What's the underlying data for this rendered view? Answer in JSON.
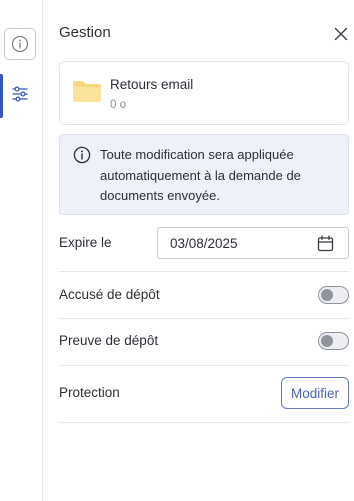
{
  "rail": {
    "items": [
      {
        "icon": "info-icon",
        "active": false
      },
      {
        "icon": "sliders-icon",
        "active": true
      }
    ],
    "accent_color": "#3454c4"
  },
  "panel": {
    "title": "Gestion",
    "close_icon": "close-icon"
  },
  "folder": {
    "icon": "folder-icon",
    "name": "Retours email",
    "size": "0 o",
    "icon_color": "#f6d77e"
  },
  "info": {
    "icon": "info-circle-icon",
    "text": "Toute modification sera appliquée automatiquement à la demande de documents envoyée."
  },
  "settings": {
    "expire": {
      "label": "Expire le",
      "date": "03/08/2025",
      "icon": "calendar-icon"
    },
    "accuse": {
      "label": "Accusé de dépôt",
      "enabled": false
    },
    "preuve": {
      "label": "Preuve de dépôt",
      "enabled": false
    },
    "protection": {
      "label": "Protection",
      "button_label": "Modifier"
    }
  }
}
